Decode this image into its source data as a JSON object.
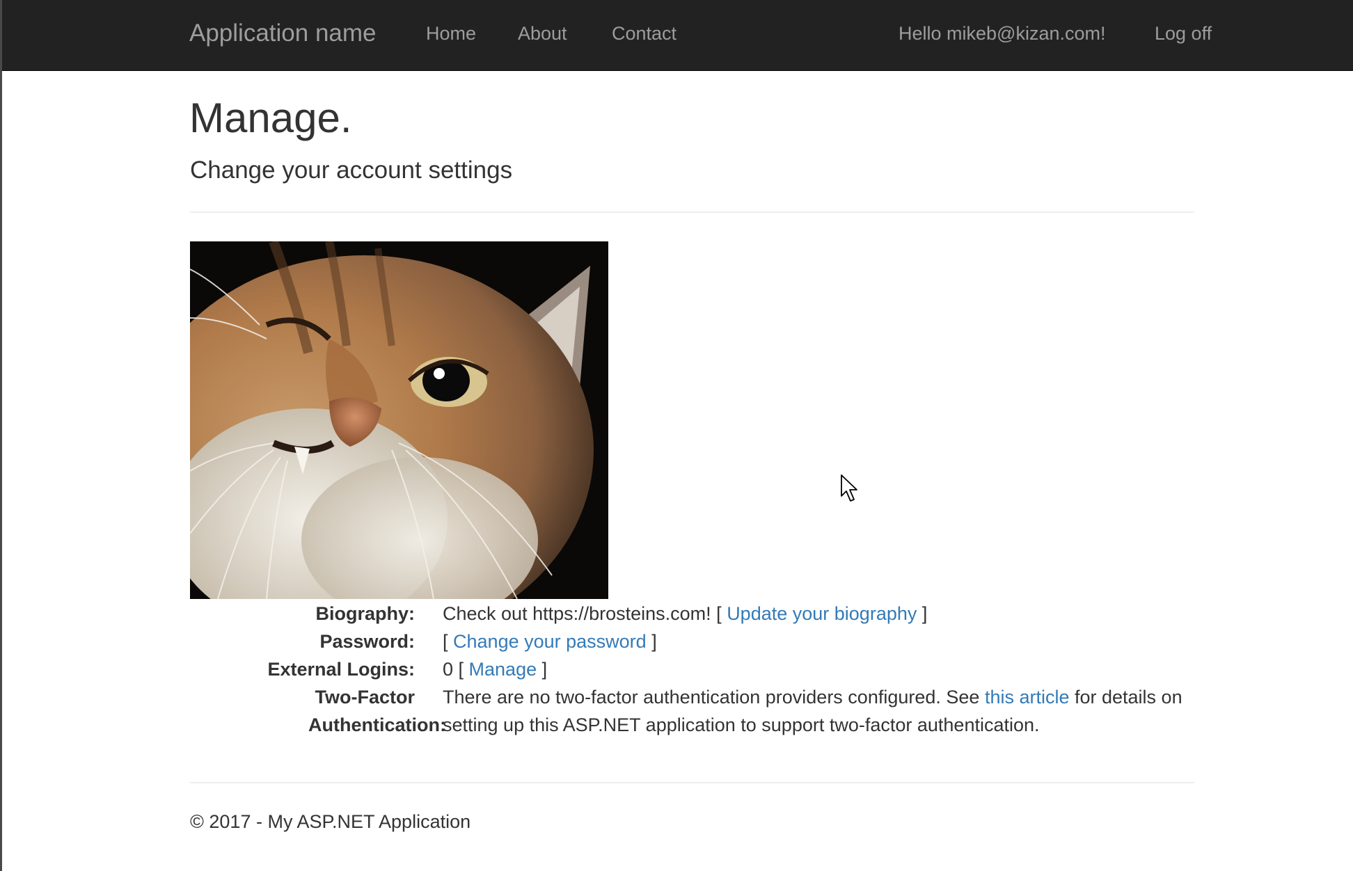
{
  "navbar": {
    "brand": "Application name",
    "links": [
      "Home",
      "About",
      "Contact"
    ],
    "greeting": "Hello mikeb@kizan.com!",
    "logoff": "Log off"
  },
  "page": {
    "title": "Manage.",
    "subtitle": "Change your account settings"
  },
  "profile": {
    "biography_label": "Biography:",
    "biography_text": "Check out https://brosteins.com! [ ",
    "biography_link": "Update your biography",
    "biography_suffix": " ]",
    "password_label": "Password:",
    "password_prefix": "[ ",
    "password_link": "Change your password",
    "password_suffix": " ]",
    "external_label": "External Logins:",
    "external_prefix": "0 [ ",
    "external_link": "Manage",
    "external_suffix": " ]",
    "twofactor_label": "Two-Factor Authentication:",
    "twofactor_text": "There are no two-factor authentication providers configured. See ",
    "twofactor_link": "this article",
    "twofactor_suffix": " for details on setting up this ASP.NET application to support two-factor authentication."
  },
  "footer": {
    "text": "© 2017 - My ASP.NET Application"
  },
  "colors": {
    "navbar_bg": "#222222",
    "navbar_text": "#9d9d9d",
    "link": "#337ab7",
    "text": "#333333"
  },
  "icons": {
    "avatar": "cat-photo",
    "cursor": "mouse-pointer-icon"
  }
}
